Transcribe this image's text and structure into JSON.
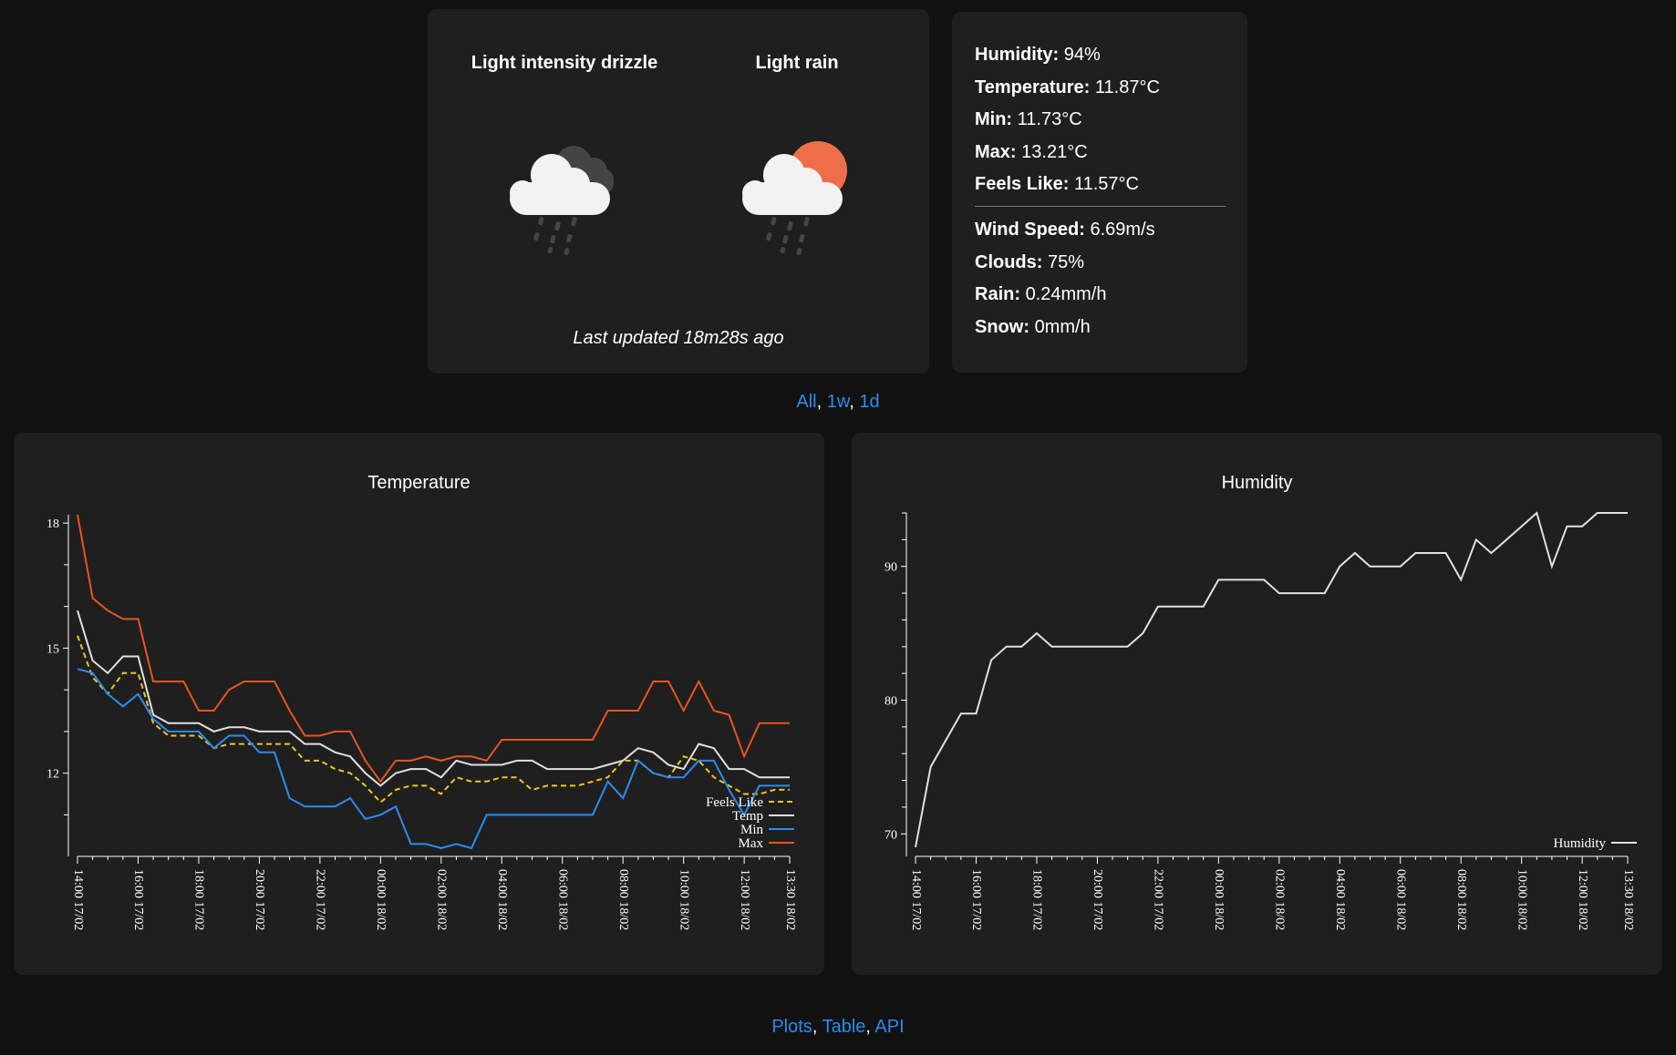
{
  "current": {
    "conditions": [
      {
        "title": "Light intensity drizzle",
        "icon": "cloud-drizzle-icon"
      },
      {
        "title": "Light rain",
        "icon": "sun-cloud-rain-icon"
      }
    ],
    "last_updated": "Last updated 18m28s ago"
  },
  "details": {
    "humidity_label": "Humidity:",
    "humidity_value": "94%",
    "temperature_label": "Temperature:",
    "temperature_value": "11.87°C",
    "min_label": "Min:",
    "min_value": "11.73°C",
    "max_label": "Max:",
    "max_value": "13.21°C",
    "feels_label": "Feels Like:",
    "feels_value": "11.57°C",
    "wind_label": "Wind Speed:",
    "wind_value": "6.69m/s",
    "clouds_label": "Clouds:",
    "clouds_value": "75%",
    "rain_label": "Rain:",
    "rain_value": "0.24mm/h",
    "snow_label": "Snow:",
    "snow_value": "0mm/h"
  },
  "range_links": {
    "all": "All",
    "week": "1w",
    "day": "1d",
    "sep": ", "
  },
  "page_links": {
    "plots": "Plots",
    "table": "Table",
    "api": "API",
    "sep": ", "
  },
  "colors": {
    "accent_link": "#2a8cf0",
    "feels": "#f0c419",
    "temp": "#e0e0e0",
    "min": "#2a8cf0",
    "max": "#e8541c",
    "humidity": "#e0e0e0",
    "sun": "#ee6e4a"
  },
  "chart_data": [
    {
      "type": "line",
      "title": "Temperature",
      "ylim": [
        10.2,
        18.2
      ],
      "yticks": [
        12,
        15,
        18
      ],
      "xlabels": [
        "14:00 17/02",
        "16:00 17/02",
        "18:00 17/02",
        "20:00 17/02",
        "22:00 17/02",
        "00:00 18/02",
        "02:00 18/02",
        "04:00 18/02",
        "06:00 18/02",
        "08:00 18/02",
        "10:00 18/02",
        "12:00 18/02",
        "13:30 18/02"
      ],
      "x_hours": [
        0,
        0.5,
        1,
        1.5,
        2,
        2.5,
        3,
        3.5,
        4,
        4.5,
        5,
        5.5,
        6,
        6.5,
        7,
        7.5,
        8,
        8.5,
        9,
        9.5,
        10,
        10.5,
        11,
        11.5,
        12,
        12.5,
        13,
        13.5,
        14,
        14.5,
        15,
        15.5,
        16,
        16.5,
        17,
        17.5,
        18,
        18.5,
        19,
        19.5,
        20,
        20.5,
        21,
        21.5,
        22,
        22.5,
        23,
        23.5
      ],
      "series": [
        {
          "name": "Feels Like",
          "color": "#f0c419",
          "dash": true,
          "values": [
            15.3,
            14.3,
            13.9,
            14.4,
            14.4,
            13.2,
            12.9,
            12.9,
            12.9,
            12.6,
            12.7,
            12.7,
            12.7,
            12.7,
            12.7,
            12.3,
            12.3,
            12.1,
            12.0,
            11.7,
            11.3,
            11.6,
            11.7,
            11.7,
            11.5,
            11.9,
            11.8,
            11.8,
            11.9,
            11.9,
            11.6,
            11.7,
            11.7,
            11.7,
            11.8,
            11.9,
            12.3,
            12.3,
            12.0,
            11.9,
            12.4,
            12.3,
            11.9,
            11.7,
            11.5,
            11.5,
            11.6,
            11.6
          ]
        },
        {
          "name": "Temp",
          "color": "#e0e0e0",
          "dash": false,
          "values": [
            15.9,
            14.7,
            14.4,
            14.8,
            14.8,
            13.4,
            13.2,
            13.2,
            13.2,
            13.0,
            13.1,
            13.1,
            13.0,
            13.0,
            13.0,
            12.7,
            12.7,
            12.5,
            12.4,
            12.0,
            11.7,
            12.0,
            12.1,
            12.1,
            11.9,
            12.3,
            12.2,
            12.2,
            12.2,
            12.3,
            12.3,
            12.1,
            12.1,
            12.1,
            12.1,
            12.2,
            12.3,
            12.6,
            12.5,
            12.2,
            12.1,
            12.7,
            12.6,
            12.1,
            12.1,
            11.9,
            11.9,
            11.9
          ]
        },
        {
          "name": "Min",
          "color": "#2a8cf0",
          "dash": false,
          "values": [
            14.5,
            14.4,
            13.9,
            13.6,
            13.9,
            13.3,
            13.0,
            13.0,
            13.0,
            12.6,
            12.9,
            12.9,
            12.5,
            12.5,
            11.4,
            11.2,
            11.2,
            11.2,
            11.4,
            10.9,
            11.0,
            11.2,
            10.3,
            10.3,
            10.2,
            10.3,
            10.2,
            11.0,
            11.0,
            11.0,
            11.0,
            11.0,
            11.0,
            11.0,
            11.0,
            11.8,
            11.4,
            12.3,
            12.0,
            11.9,
            11.9,
            12.3,
            12.3,
            11.6,
            11.0,
            11.7,
            11.7,
            11.7
          ]
        },
        {
          "name": "Max",
          "color": "#e8541c",
          "dash": false,
          "values": [
            18.2,
            16.2,
            15.9,
            15.7,
            15.7,
            14.2,
            14.2,
            14.2,
            13.5,
            13.5,
            14.0,
            14.2,
            14.2,
            14.2,
            13.5,
            12.9,
            12.9,
            13.0,
            13.0,
            12.3,
            11.8,
            12.3,
            12.3,
            12.4,
            12.3,
            12.4,
            12.4,
            12.3,
            12.8,
            12.8,
            12.8,
            12.8,
            12.8,
            12.8,
            12.8,
            13.5,
            13.5,
            13.5,
            14.2,
            14.2,
            13.5,
            14.2,
            13.5,
            13.4,
            12.4,
            13.2,
            13.2,
            13.2
          ]
        }
      ]
    },
    {
      "type": "line",
      "title": "Humidity",
      "ylim": [
        69,
        94
      ],
      "yticks": [
        70,
        80,
        90
      ],
      "xlabels": [
        "14:00 17/02",
        "16:00 17/02",
        "18:00 17/02",
        "20:00 17/02",
        "22:00 17/02",
        "00:00 18/02",
        "02:00 18/02",
        "04:00 18/02",
        "06:00 18/02",
        "08:00 18/02",
        "10:00 18/02",
        "12:00 18/02",
        "13:30 18/02"
      ],
      "x_hours": [
        0,
        0.5,
        1,
        1.5,
        2,
        2.5,
        3,
        3.5,
        4,
        4.5,
        5,
        5.5,
        6,
        6.5,
        7,
        7.5,
        8,
        8.5,
        9,
        9.5,
        10,
        10.5,
        11,
        11.5,
        12,
        12.5,
        13,
        13.5,
        14,
        14.5,
        15,
        15.5,
        16,
        16.5,
        17,
        17.5,
        18,
        18.5,
        19,
        19.5,
        20,
        20.5,
        21,
        21.5,
        22,
        22.5,
        23,
        23.5
      ],
      "series": [
        {
          "name": "Humidity",
          "color": "#e0e0e0",
          "dash": false,
          "values": [
            69,
            75,
            77,
            79,
            79,
            83,
            84,
            84,
            85,
            84,
            84,
            84,
            84,
            84,
            84,
            85,
            87,
            87,
            87,
            87,
            89,
            89,
            89,
            89,
            88,
            88,
            88,
            88,
            90,
            91,
            90,
            90,
            90,
            91,
            91,
            91,
            89,
            92,
            91,
            92,
            93,
            94,
            90,
            93,
            93,
            94,
            94,
            94
          ]
        }
      ]
    }
  ]
}
